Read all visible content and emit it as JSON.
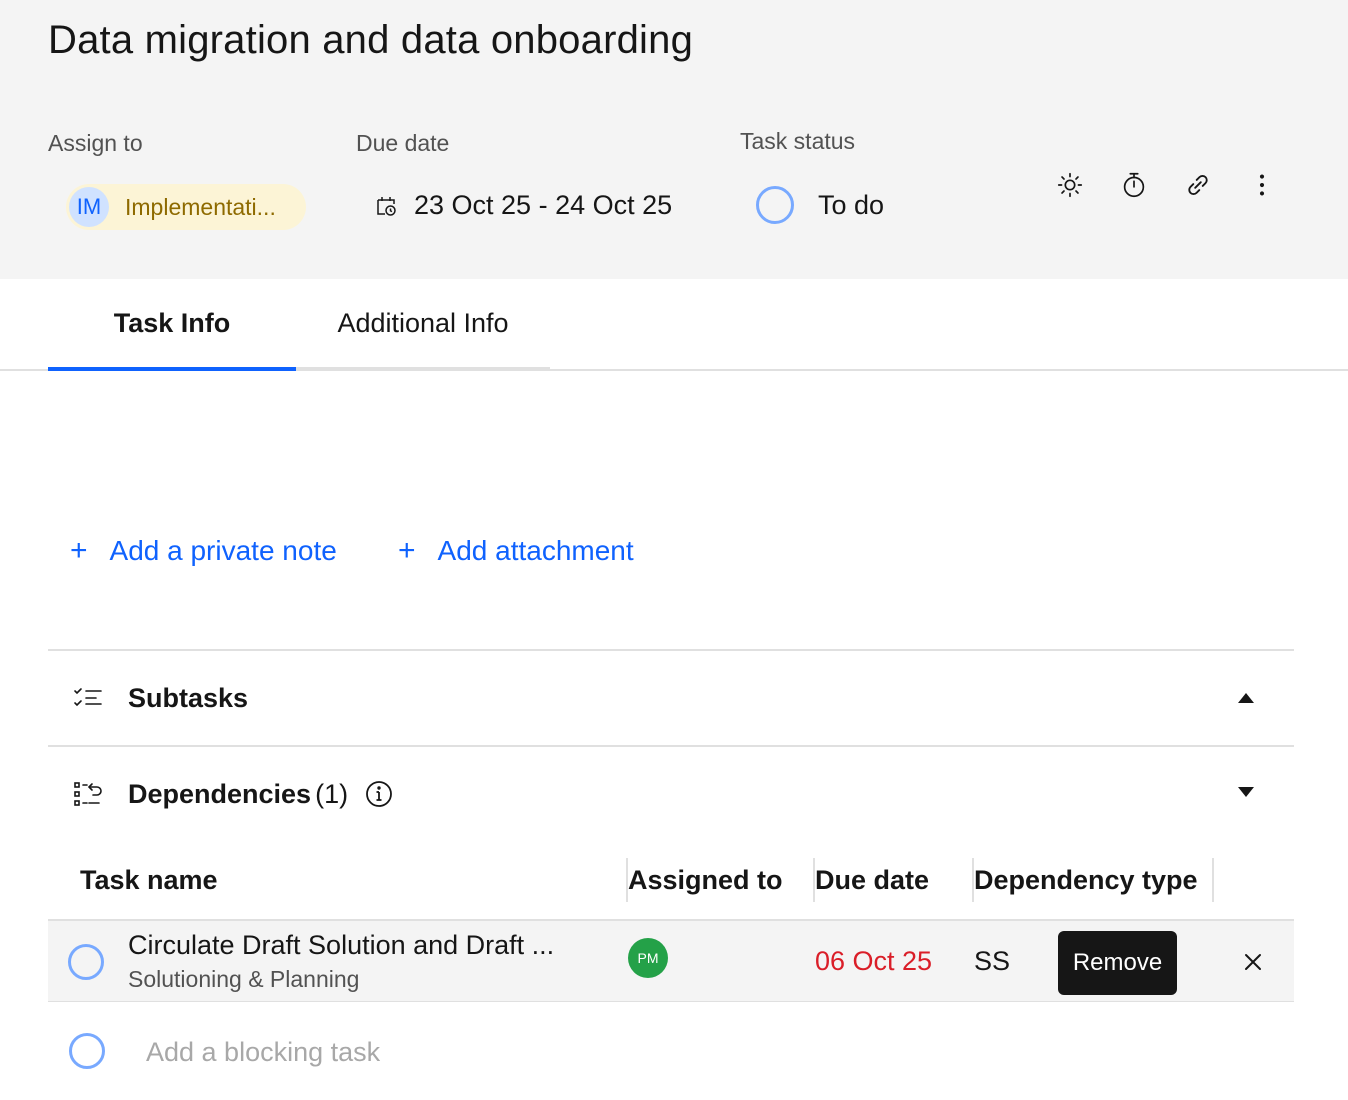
{
  "task": {
    "title": "Data migration and data onboarding"
  },
  "fields": {
    "assign_label": "Assign to",
    "due_label": "Due date",
    "status_label": "Task status",
    "assignee_initials": "IM",
    "assignee_name": "Implementati...",
    "due_range": "23 Oct 25 - 24 Oct 25",
    "status_value": "To do"
  },
  "header_icons": [
    "brightness-icon",
    "timer-icon",
    "link-icon",
    "overflow-menu-icon"
  ],
  "tabs": [
    {
      "label": "Task Info",
      "selected": true
    },
    {
      "label": "Additional Info",
      "selected": false
    }
  ],
  "actions": {
    "add_note": "Add a private note",
    "add_attachment": "Add attachment",
    "plus": "+"
  },
  "sections": {
    "subtasks": {
      "title": "Subtasks",
      "expanded": false
    },
    "dependencies": {
      "title": "Dependencies",
      "count": "(1)",
      "expanded": true
    }
  },
  "dependency_table": {
    "headers": [
      "Task name",
      "Assigned to",
      "Due date",
      "Dependency type"
    ],
    "rows": [
      {
        "name": "Circulate Draft Solution and Draft ...",
        "subtitle": "Solutioning & Planning",
        "assignee_initials": "PM",
        "due": "06 Oct 25",
        "dep_type": "SS"
      }
    ],
    "remove_tooltip": "Remove",
    "add_placeholder": "Add a blocking task"
  },
  "colors": {
    "accent": "#0f62fe",
    "status_circle": "#78a9ff",
    "overdue": "#da1e28",
    "assignee_pill": "#fcf4d6",
    "assignee_text": "#8e6a00",
    "pm_avatar": "#24a148",
    "header_bg": "#f4f4f4"
  }
}
